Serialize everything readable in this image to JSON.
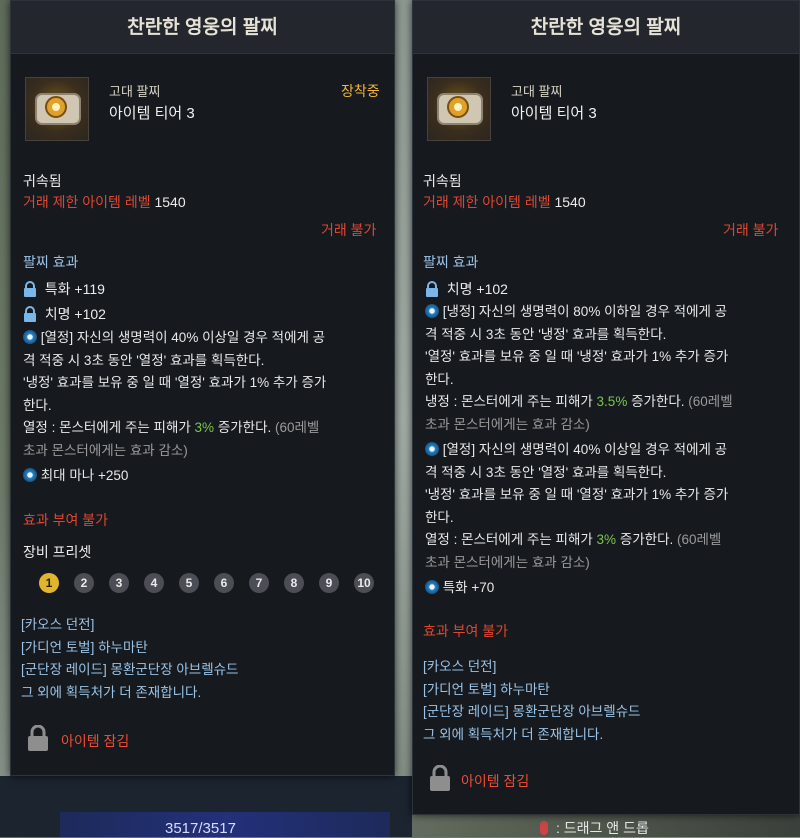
{
  "left_panel": {
    "title": "찬란한 영웅의 팔찌",
    "item_grade": "고대 팔찌",
    "item_tier": "아이템 티어 3",
    "equipped": "장착중",
    "bound": "귀속됨",
    "trade_level_label": "거래 제한 아이템 레벨",
    "trade_level_value": "1540",
    "untradeable": "거래 불가",
    "effect_header": "팔찌 효과",
    "stat1": "특화 +119",
    "stat2": "치명 +102",
    "effect": {
      "line1": "[열정] 자신의 생명력이 40% 이상일 경우 적에게 공",
      "line2": "격 적중 시 3초 동안 '열정' 효과를 획득한다.",
      "line3": "'냉정' 효과를 보유 중 일 때 '열정' 효과가 1% 추가 증가",
      "line4": "한다.",
      "line5a": "열정 : 몬스터에게 주는 피해가 ",
      "line5b": "3%",
      "line5c": " 증가한다. ",
      "line5d": "(60레벨",
      "line6": "초과 몬스터에게는 효과 감소)"
    },
    "stat3": "최대 마나 +250",
    "no_effect_grant": "효과 부여 불가",
    "preset_label": "장비 프리셋",
    "presets": [
      "1",
      "2",
      "3",
      "4",
      "5",
      "6",
      "7",
      "8",
      "9",
      "10"
    ],
    "source1": "[카오스 던전]",
    "source2": "[가디언 토벌] 하누마탄",
    "source3": "[군단장 레이드] 몽환군단장 아브렐슈드",
    "source_more": "그 외에 획득처가 더 존재합니다.",
    "locked": "아이템 잠김"
  },
  "right_panel": {
    "title": "찬란한 영웅의 팔찌",
    "item_grade": "고대 팔찌",
    "item_tier": "아이템 티어 3",
    "bound": "귀속됨",
    "trade_level_label": "거래 제한 아이템 레벨",
    "trade_level_value": "1540",
    "untradeable": "거래 불가",
    "effect_header": "팔찌 효과",
    "stat1": "치명 +102",
    "effect1": {
      "line1": "[냉정] 자신의 생명력이 80% 이하일 경우 적에게 공",
      "line2": "격 적중 시 3초 동안 '냉정' 효과를 획득한다.",
      "line3": "'열정' 효과를 보유 중 일 때 '냉정' 효과가 1% 추가 증가",
      "line4": "한다.",
      "line5a": "냉정 : 몬스터에게 주는 피해가 ",
      "line5b": "3.5%",
      "line5c": " 증가한다. ",
      "line5d": "(60레벨",
      "line6": "초과 몬스터에게는 효과 감소)"
    },
    "effect2": {
      "line1": "[열정] 자신의 생명력이 40% 이상일 경우 적에게 공",
      "line2": "격 적중 시 3초 동안 '열정' 효과를 획득한다.",
      "line3": "'냉정' 효과를 보유 중 일 때 '열정' 효과가 1% 추가 증가",
      "line4": "한다.",
      "line5a": "열정 : 몬스터에게 주는 피해가 ",
      "line5b": "3%",
      "line5c": " 증가한다. ",
      "line5d": "(60레벨",
      "line6": "초과 몬스터에게는 효과 감소)"
    },
    "stat2": "특화 +70",
    "no_effect_grant": "효과 부여 불가",
    "source1": "[카오스 던전]",
    "source2": "[가디언 토벌] 하누마탄",
    "source3": "[군단장 레이드] 몽환군단장 아브렐슈드",
    "source_more": "그 외에 획득처가 더 존재합니다.",
    "locked": "아이템 잠김"
  },
  "background": {
    "hp_readout": "3517/3517",
    "drag_drop_hint": ": 드래그 앤 드롭"
  },
  "colors": {
    "panel_bg": "#161a1f",
    "red_text": "#e0462f",
    "blue_text": "#9bc3e6",
    "green_text": "#79c64a",
    "gold_text": "#f2b43a"
  }
}
